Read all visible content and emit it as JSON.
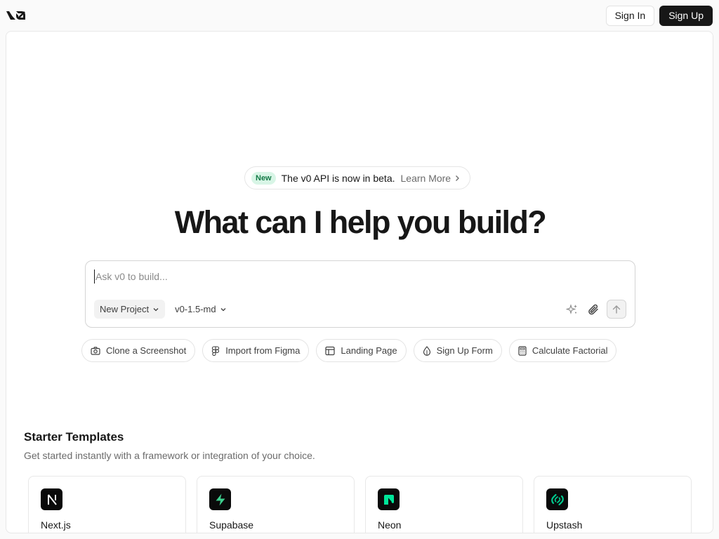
{
  "header": {
    "logo": "v0-logo",
    "sign_in": "Sign In",
    "sign_up": "Sign Up"
  },
  "announcement": {
    "badge": "New",
    "text": "The v0 API is now in beta.",
    "link": "Learn More"
  },
  "hero": {
    "title": "What can I help you build?"
  },
  "composer": {
    "placeholder": "Ask v0 to build...",
    "project_select": "New Project",
    "model_select": "v0-1.5-md"
  },
  "suggestions": [
    {
      "label": "Clone a Screenshot",
      "icon": "camera-icon"
    },
    {
      "label": "Import from Figma",
      "icon": "figma-icon"
    },
    {
      "label": "Landing Page",
      "icon": "layout-icon"
    },
    {
      "label": "Sign Up Form",
      "icon": "droplet-icon"
    },
    {
      "label": "Calculate Factorial",
      "icon": "calculator-icon"
    }
  ],
  "starter": {
    "title": "Starter Templates",
    "subtitle": "Get started instantly with a framework or integration of your choice.",
    "cards": [
      {
        "name": "Next.js",
        "icon": "nextjs-icon"
      },
      {
        "name": "Supabase",
        "icon": "supabase-icon"
      },
      {
        "name": "Neon",
        "icon": "neon-icon"
      },
      {
        "name": "Upstash",
        "icon": "upstash-icon"
      }
    ]
  },
  "colors": {
    "accent_dark": "#171717",
    "badge_bg": "#d8f5e6",
    "badge_text": "#147a47",
    "supabase_green": "#3ecf8e",
    "neon_green": "#00e599",
    "upstash_green": "#00c98d"
  }
}
